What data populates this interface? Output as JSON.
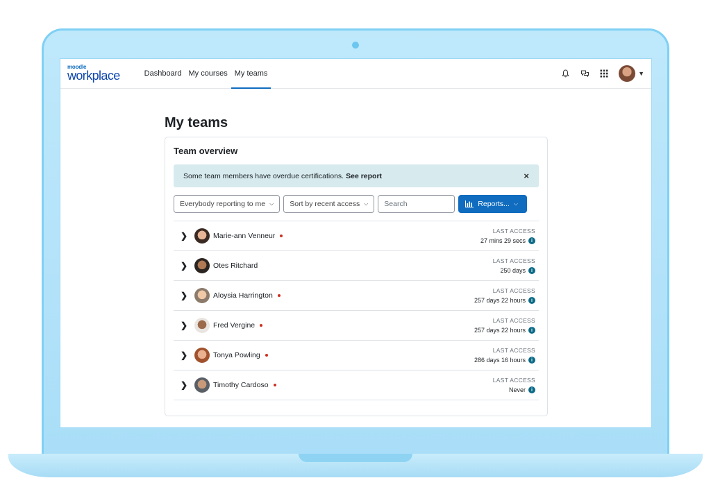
{
  "brand": {
    "small": "moodle",
    "big": "workplace"
  },
  "nav": {
    "links": [
      {
        "label": "Dashboard",
        "active": false
      },
      {
        "label": "My courses",
        "active": false
      },
      {
        "label": "My teams",
        "active": true
      }
    ],
    "icons": [
      "bell-icon",
      "chat-icon",
      "app-grid-icon"
    ]
  },
  "page": {
    "title": "My teams"
  },
  "card": {
    "title": "Team overview",
    "alert": {
      "text": "Some team members have overdue certifications.",
      "link": "See report",
      "close": "×"
    },
    "controls": {
      "filter": "Everybody reporting to me",
      "sort": "Sort by recent access",
      "search_placeholder": "Search",
      "reports_label": "Reports..."
    },
    "access_label": "LAST ACCESS",
    "members": [
      {
        "name": "Marie-ann Venneur",
        "overdue": true,
        "last_access": "27 mins 29 secs"
      },
      {
        "name": "Otes Ritchard",
        "overdue": false,
        "last_access": "250 days"
      },
      {
        "name": "Aloysia Harrington",
        "overdue": true,
        "last_access": "257 days 22 hours"
      },
      {
        "name": "Fred Vergine",
        "overdue": true,
        "last_access": "257 days 22 hours"
      },
      {
        "name": "Tonya Powling",
        "overdue": true,
        "last_access": "286 days 16 hours"
      },
      {
        "name": "Timothy Cardoso",
        "overdue": true,
        "last_access": "Never"
      }
    ]
  },
  "colors": {
    "primary": "#0f6cbf",
    "alert_bg": "#d7ebef",
    "overdue": "#ca3120",
    "info": "#0b6a86",
    "frame": "#a9def8"
  }
}
